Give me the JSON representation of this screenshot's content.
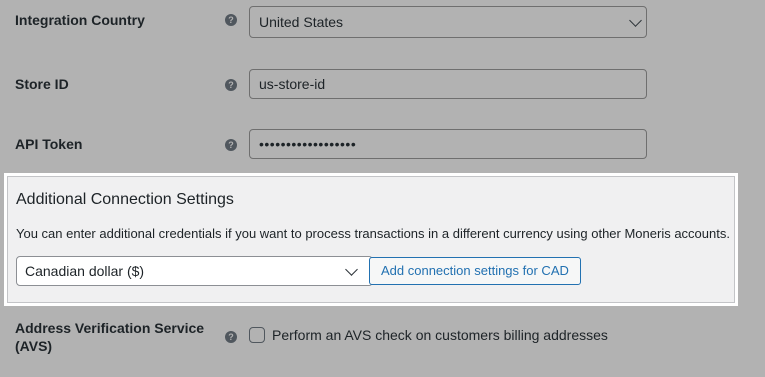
{
  "integration_country": {
    "label": "Integration Country",
    "help_glyph": "?",
    "value": "United States"
  },
  "store_id": {
    "label": "Store ID",
    "help_glyph": "?",
    "value": "us-store-id"
  },
  "api_token": {
    "label": "API Token",
    "help_glyph": "?",
    "value": "••••••••••••••••••"
  },
  "additional_settings": {
    "title": "Additional Connection Settings",
    "description": "You can enter additional credentials if you want to process transactions in a different currency using other Moneris accounts.",
    "currency_value": "Canadian dollar ($)",
    "add_button_label": "Add connection settings for CAD"
  },
  "avs": {
    "label_line1": "Address Verification Service",
    "label_line2": "(AVS)",
    "help_glyph": "?",
    "checkbox_label": "Perform an AVS check on customers billing addresses",
    "checked": false
  },
  "colors": {
    "overlay_bg": "#b2b2b2",
    "panel_bg": "#f0f0f1",
    "accent": "#2271b1",
    "text": "#1d2327"
  }
}
